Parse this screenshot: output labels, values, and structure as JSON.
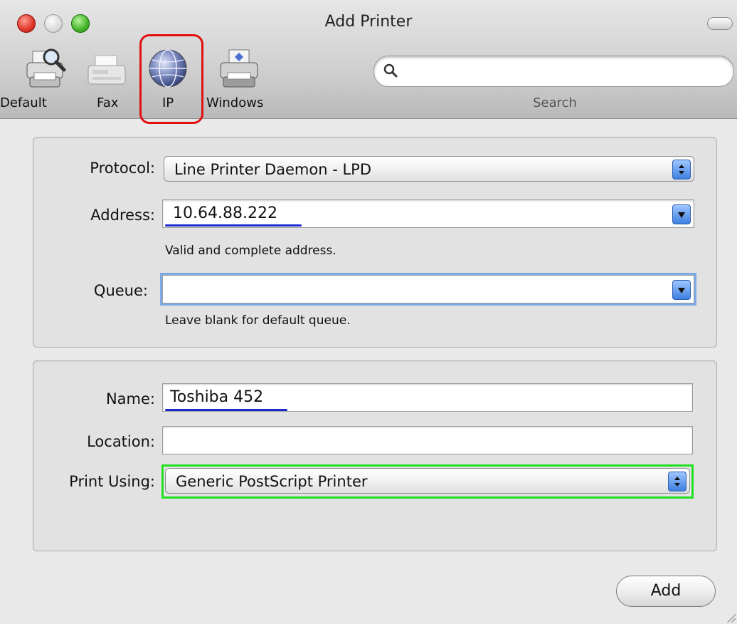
{
  "window": {
    "title": "Add Printer"
  },
  "toolbar": {
    "items": [
      {
        "label": "Default",
        "icon": "default-printer-icon"
      },
      {
        "label": "Fax",
        "icon": "fax-icon"
      },
      {
        "label": "IP",
        "icon": "globe-icon"
      },
      {
        "label": "Windows",
        "icon": "windows-printer-icon"
      }
    ],
    "search": {
      "value": "",
      "label": "Search",
      "icon": "magnifier-icon"
    }
  },
  "connection": {
    "protocol": {
      "label": "Protocol:",
      "value": "Line Printer Daemon - LPD"
    },
    "address": {
      "label": "Address:",
      "value": "10.64.88.222",
      "help": "Valid and complete address."
    },
    "queue": {
      "label": "Queue:",
      "value": "",
      "help": "Leave blank for default queue."
    }
  },
  "printer": {
    "name": {
      "label": "Name:",
      "value": "Toshiba 452"
    },
    "location": {
      "label": "Location:",
      "value": ""
    },
    "print_using": {
      "label": "Print Using:",
      "value": "Generic PostScript Printer"
    }
  },
  "actions": {
    "add_label": "Add"
  },
  "colors": {
    "ip_highlight": "#e01010",
    "print_using_highlight": "#20e020",
    "underline": "#1b2bd0",
    "popup_arrows": "#3d7fe0"
  }
}
